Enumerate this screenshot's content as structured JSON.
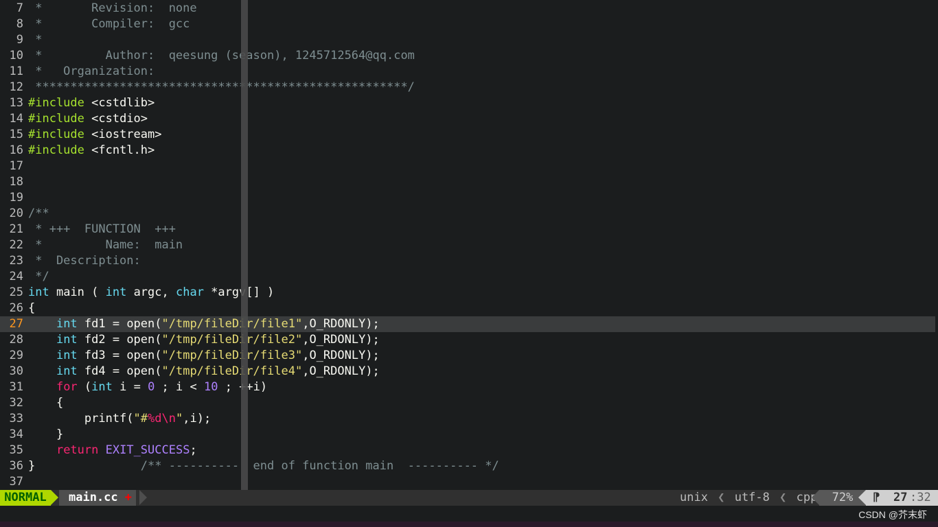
{
  "editor": {
    "lines": [
      {
        "num": "7",
        "code": " *       Revision:  none"
      },
      {
        "num": "8",
        "code": " *       Compiler:  gcc"
      },
      {
        "num": "9",
        "code": " *"
      },
      {
        "num": "10",
        "code": " *         Author:  qeesung (season), 1245712564@qq.com"
      },
      {
        "num": "11",
        "code": " *   Organization:"
      },
      {
        "num": "12",
        "code": " *****************************************************/"
      },
      {
        "num": "13",
        "code": "#include <cstdlib>"
      },
      {
        "num": "14",
        "code": "#include <cstdio>"
      },
      {
        "num": "15",
        "code": "#include <iostream>"
      },
      {
        "num": "16",
        "code": "#include <fcntl.h>"
      },
      {
        "num": "17",
        "code": ""
      },
      {
        "num": "18",
        "code": ""
      },
      {
        "num": "19",
        "code": ""
      },
      {
        "num": "20",
        "code": "/**"
      },
      {
        "num": "21",
        "code": " * +++  FUNCTION  +++"
      },
      {
        "num": "22",
        "code": " *         Name:  main"
      },
      {
        "num": "23",
        "code": " *  Description:"
      },
      {
        "num": "24",
        "code": " */"
      },
      {
        "num": "25",
        "code": "int main ( int argc, char *argv[] )"
      },
      {
        "num": "26",
        "code": "{"
      },
      {
        "num": "27",
        "code": "    int fd1 = open(\"/tmp/fileDir/file1\",O_RDONLY);"
      },
      {
        "num": "28",
        "code": "    int fd2 = open(\"/tmp/fileDir/file2\",O_RDONLY);"
      },
      {
        "num": "29",
        "code": "    int fd3 = open(\"/tmp/fileDir/file3\",O_RDONLY);"
      },
      {
        "num": "30",
        "code": "    int fd4 = open(\"/tmp/fileDir/file4\",O_RDONLY);"
      },
      {
        "num": "31",
        "code": "    for (int i = 0 ; i < 10 ; ++i)"
      },
      {
        "num": "32",
        "code": "    {"
      },
      {
        "num": "33",
        "code": "        printf(\"#%d\\n\",i);"
      },
      {
        "num": "34",
        "code": "    }"
      },
      {
        "num": "35",
        "code": "    return EXIT_SUCCESS;"
      },
      {
        "num": "36",
        "code": "}               /** ----------  end of function main  ---------- */"
      },
      {
        "num": "37",
        "code": ""
      }
    ],
    "current_line": "27"
  },
  "statusline": {
    "mode": "NORMAL",
    "filename": "main.cc",
    "modified": "+",
    "fileformat": "unix",
    "encoding": "utf-8",
    "filetype": "cpp",
    "sep": "❮",
    "percent": "72%",
    "line_icon": "⁋",
    "row": "27",
    "col": ":32"
  },
  "watermark": "CSDN @芥末虾",
  "colors": {
    "background": "#1b1d1e",
    "comment": "#7e8e91",
    "preproc": "#a6e22e",
    "type": "#66d9ef",
    "string": "#e6db74",
    "keyword": "#f92672",
    "number": "#ae81ff",
    "mode_bg": "#afd700"
  }
}
